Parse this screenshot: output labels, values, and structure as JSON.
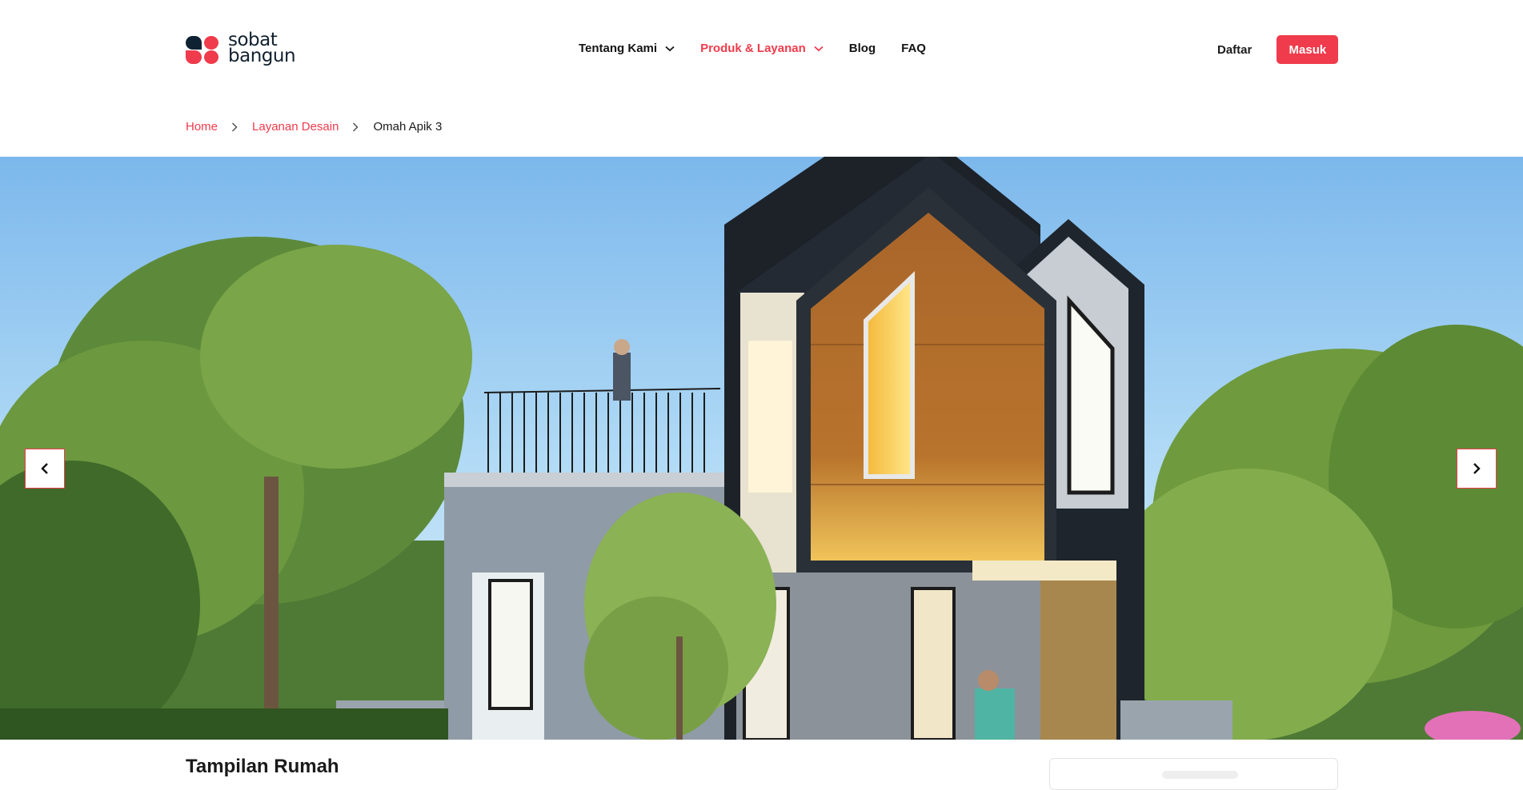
{
  "brand": {
    "name_line1": "sobat",
    "name_line2": "bangun",
    "accent": "#ef3b4c",
    "dark": "#0f2233"
  },
  "nav": {
    "items": [
      {
        "label": "Tentang Kami",
        "has_dropdown": true,
        "active": false
      },
      {
        "label": "Produk & Layanan",
        "has_dropdown": true,
        "active": true
      },
      {
        "label": "Blog",
        "has_dropdown": false,
        "active": false
      },
      {
        "label": "FAQ",
        "has_dropdown": false,
        "active": false
      }
    ]
  },
  "auth": {
    "register_label": "Daftar",
    "login_label": "Masuk"
  },
  "breadcrumb": {
    "items": [
      "Home",
      "Layanan Desain"
    ],
    "current": "Omah Apik 3"
  },
  "carousel": {
    "prev_icon": "chevron-left-icon",
    "next_icon": "chevron-right-icon"
  },
  "main": {
    "section_title": "Tampilan Rumah"
  }
}
